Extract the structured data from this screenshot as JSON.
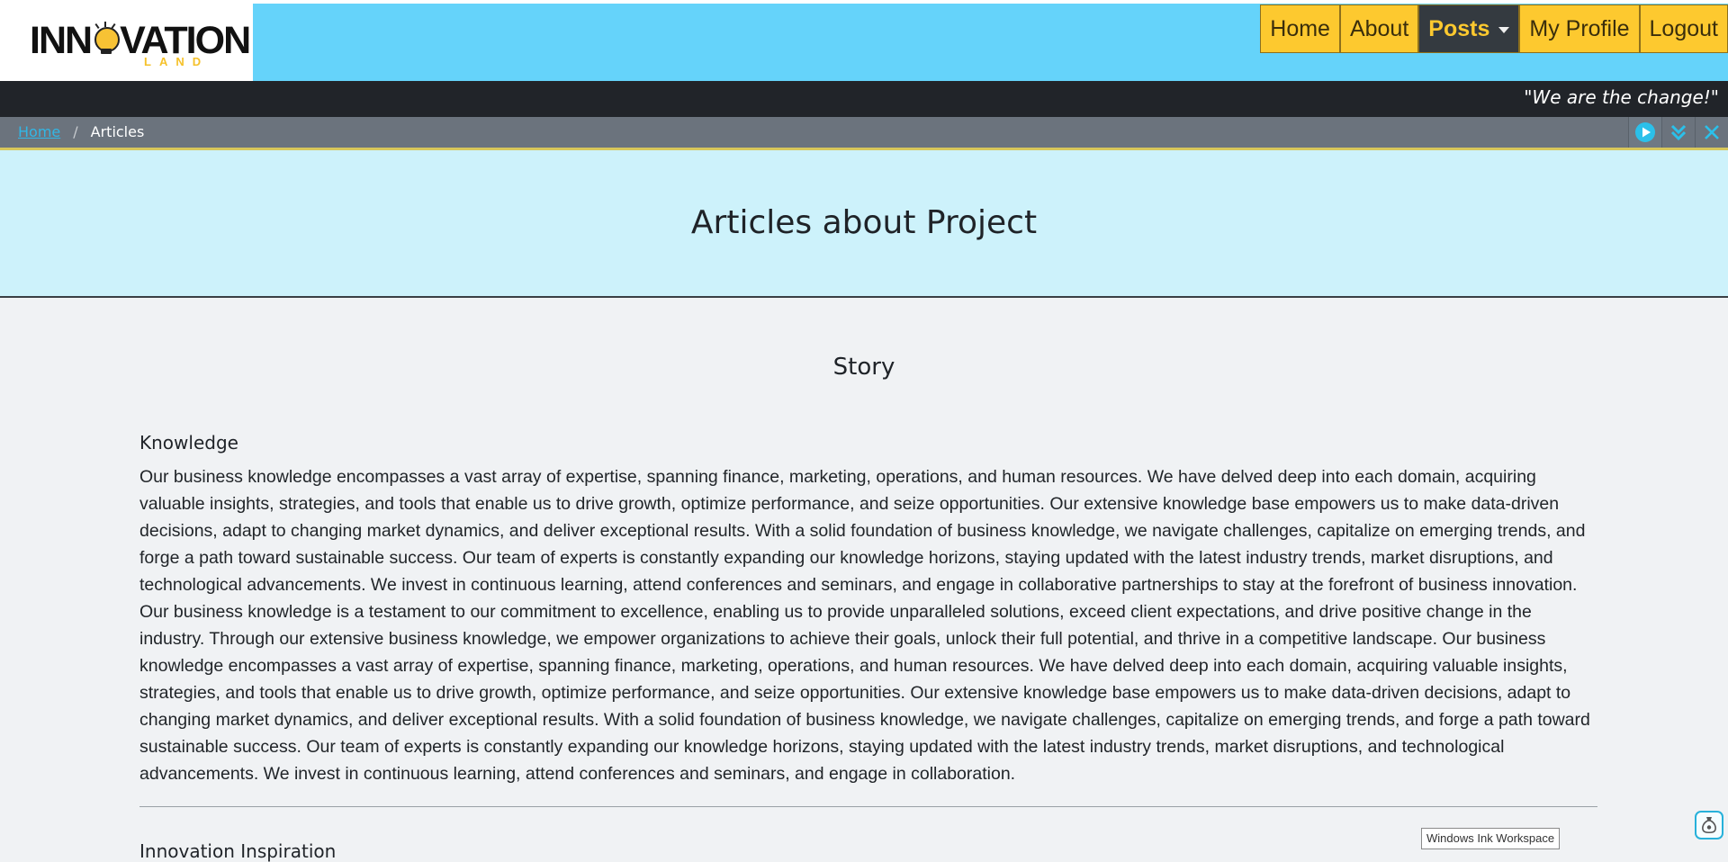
{
  "brand": {
    "name": "INNOVATION",
    "sub": "LAND"
  },
  "nav": {
    "items": [
      {
        "label": "Home"
      },
      {
        "label": "About"
      },
      {
        "label": "Posts",
        "active": true,
        "dropdown": true
      },
      {
        "label": "My Profile"
      },
      {
        "label": "Logout"
      }
    ]
  },
  "tagline": "\"We are the change!\"",
  "breadcrumb": {
    "home": "Home",
    "separator": "/",
    "current": "Articles"
  },
  "toolbar_icons": [
    "play-icon",
    "chevrons-down-icon",
    "close-icon"
  ],
  "hero": {
    "title": "Articles about Project"
  },
  "story": {
    "title": "Story",
    "knowledge_title": "Knowledge",
    "knowledge_text": "Our business knowledge encompasses a vast array of expertise, spanning finance, marketing, operations, and human resources. We have delved deep into each domain, acquiring valuable insights, strategies, and tools that enable us to drive growth, optimize performance, and seize opportunities. Our extensive knowledge base empowers us to make data-driven decisions, adapt to changing market dynamics, and deliver exceptional results. With a solid foundation of business knowledge, we navigate challenges, capitalize on emerging trends, and forge a path toward sustainable success. Our team of experts is constantly expanding our knowledge horizons, staying updated with the latest industry trends, market disruptions, and technological advancements. We invest in continuous learning, attend conferences and seminars, and engage in collaborative partnerships to stay at the forefront of business innovation. Our business knowledge is a testament to our commitment to excellence, enabling us to provide unparalleled solutions, exceed client expectations, and drive positive change in the industry. Through our extensive business knowledge, we empower organizations to achieve their goals, unlock their full potential, and thrive in a competitive landscape. Our business knowledge encompasses a vast array of expertise, spanning finance, marketing, operations, and human resources. We have delved deep into each domain, acquiring valuable insights, strategies, and tools that enable us to drive growth, optimize performance, and seize opportunities. Our extensive knowledge base empowers us to make data-driven decisions, adapt to changing market dynamics, and deliver exceptional results. With a solid foundation of business knowledge, we navigate challenges, capitalize on emerging trends, and forge a path toward sustainable success. Our team of experts is constantly expanding our knowledge horizons, staying updated with the latest industry trends, market disruptions, and technological advancements. We invest in continuous learning, attend conferences and seminars, and engage in collaboration.",
    "next_title": "Innovation Inspiration"
  },
  "windows_ink": {
    "label": "Windows Ink Workspace",
    "icon": "windows-ink-icon"
  },
  "colors": {
    "navbar": "#65d3fa",
    "nav_item": "#fdc92f",
    "nav_active": "#343a40",
    "tagline_bar": "#212429",
    "breadcrumb_bar": "#6b737d",
    "hero": "#cdf2fb",
    "page_bg": "#f0f2f4"
  }
}
